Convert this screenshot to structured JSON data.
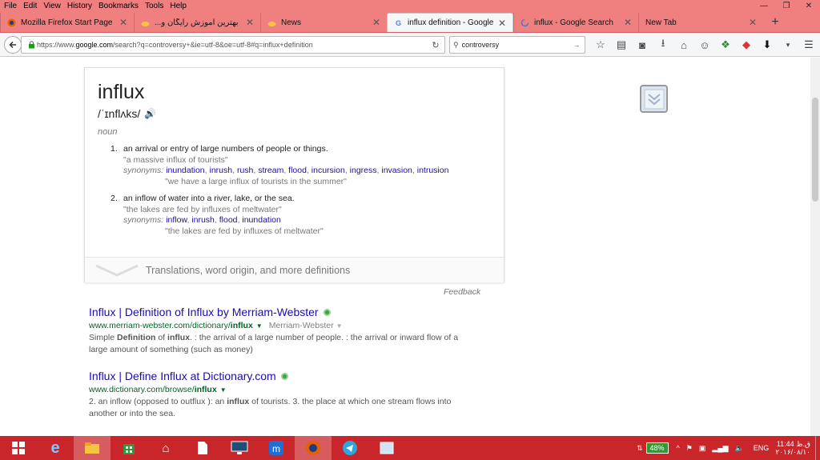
{
  "menu": [
    "File",
    "Edit",
    "View",
    "History",
    "Bookmarks",
    "Tools",
    "Help"
  ],
  "window_controls": {
    "minimize": "—",
    "restore": "❐",
    "close": "✕"
  },
  "tabs": [
    {
      "title": "Mozilla Firefox Start Page",
      "close": "✕"
    },
    {
      "title": "...بهترین آموزش رایگان و",
      "close": "✕"
    },
    {
      "title": "News",
      "close": "✕"
    },
    {
      "title": "influx definition - Google ...",
      "close": "✕"
    },
    {
      "title": "influx - Google Search",
      "close": "✕"
    },
    {
      "title": "New Tab",
      "close": "✕"
    }
  ],
  "new_tab_label": "+",
  "nav": {
    "url_prefix": "https://www.",
    "url_domain": "google.com",
    "url_rest": "/search?q=controversy+&ie=utf-8&oe=utf-8#q=influx+definition",
    "search_value": "controversy"
  },
  "dictionary": {
    "word": "influx",
    "phonetic": "/ˈɪnflʌks/",
    "part_of_speech": "noun",
    "definitions": [
      {
        "number": "1.",
        "text": "an arrival or entry of large numbers of people or things.",
        "example": "\"a massive influx of tourists\"",
        "synonyms_label": "synonyms:",
        "synonyms": [
          "inundation",
          "inrush",
          "rush",
          "stream",
          "flood",
          "incursion",
          "ingress",
          "invasion",
          "intrusion"
        ],
        "synonym_example": "\"we have a large influx of tourists in the summer\""
      },
      {
        "number": "2.",
        "text": "an inflow of water into a river, lake, or the sea.",
        "example": "\"the lakes are fed by influxes of meltwater\"",
        "synonyms_label": "synonyms:",
        "synonyms": [
          "inflow",
          "inrush",
          "flood",
          "inundation"
        ],
        "synonym_example": "\"the lakes are fed by influxes of meltwater\""
      }
    ],
    "more_label": "Translations, word origin, and more definitions",
    "feedback": "Feedback"
  },
  "results": [
    {
      "title": "Influx | Definition of Influx by Merriam-Webster",
      "url_plain": "www.merriam-webster.com/dictionary/",
      "url_bold": "influx",
      "site": "Merriam-Webster",
      "snippet_parts": [
        "Simple ",
        "Definition",
        " of ",
        "influx",
        ". : the arrival of a large number of people. : the arrival or inward flow of a large amount of something (such as money)"
      ]
    },
    {
      "title": "Influx | Define Influx at Dictionary.com",
      "url_plain": "www.dictionary.com/browse/",
      "url_bold": "influx",
      "site": "",
      "snippet_parts": [
        "2. an inflow (opposed to outflux ): an ",
        "influx",
        " of tourists. 3. the place at which one stream flows into another or into the sea."
      ]
    }
  ],
  "taskbar": {
    "battery": "48%",
    "language": "ENG",
    "time": "ق.ظ 11:44",
    "date": "۲۰۱۶/۰۸/۱۰"
  }
}
